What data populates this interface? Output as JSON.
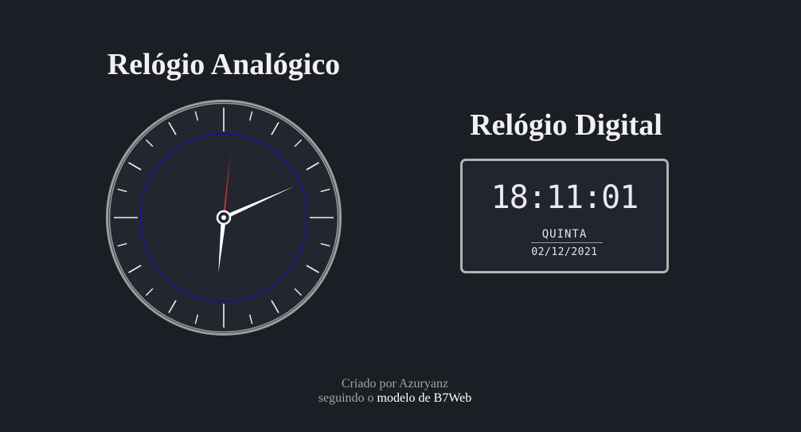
{
  "analog": {
    "title": "Relógio Analógico",
    "time": {
      "hours": 18,
      "minutes": 11,
      "seconds": 1
    },
    "colors": {
      "face": "#24262f",
      "outer_rim": "#9e9e9e",
      "tick": "#f2f2f2",
      "inner_ring": "#1212a0",
      "hour_hand": "#ffffff",
      "minute_hand": "#ffffff",
      "second_hand": "#c0353b"
    }
  },
  "digital": {
    "title": "Relógio Digital",
    "time": "18:11:01",
    "weekday": "QUINTA",
    "date": "02/12/2021"
  },
  "footer": {
    "line1": "Criado por Azuryanz",
    "line2_prefix": "seguindo o ",
    "link_text": "modelo de B7Web"
  }
}
